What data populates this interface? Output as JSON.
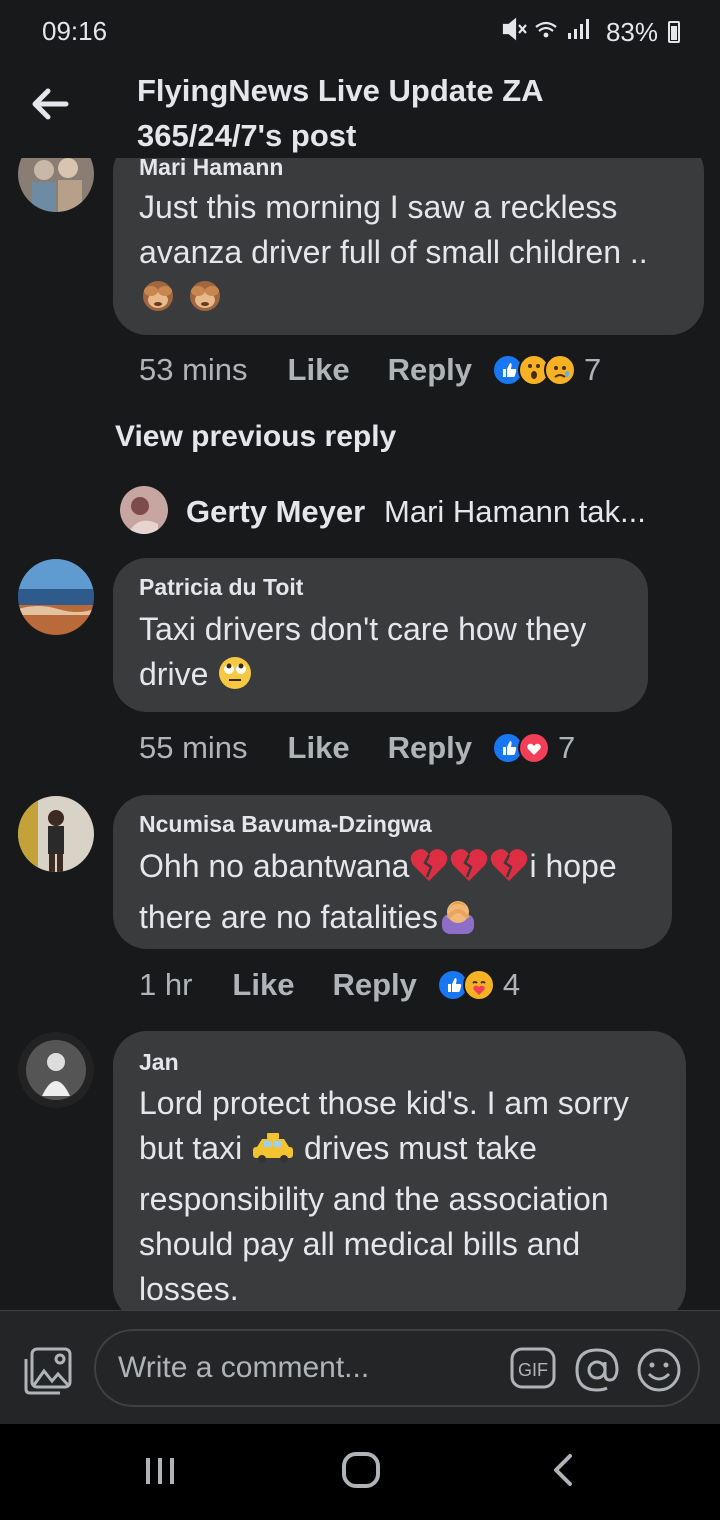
{
  "status_bar": {
    "time": "09:16",
    "battery": "83%"
  },
  "header": {
    "title_line1": "FlyingNews Live Update ZA",
    "title_line2": "365/24/7's post"
  },
  "comments": [
    {
      "author": "Mari Hamann",
      "text_line1": "Just this morning I saw a reckless",
      "text_line2": "avanza driver full of small children ..",
      "time": "53 mins",
      "like": "Like",
      "reply": "Reply",
      "reactions_count": "7"
    },
    {
      "author": "Patricia du Toit",
      "text_line1": "Taxi  drivers don't care how they",
      "text_line2": "drive",
      "time": "55 mins",
      "like": "Like",
      "reply": "Reply",
      "reactions_count": "7"
    },
    {
      "author": "Ncumisa Bavuma-Dzingwa",
      "text_line1a": "Ohh no abantwana",
      "text_line1b": "i hope",
      "text_line2": "there are no fatalities",
      "time": "1 hr",
      "like": "Like",
      "reply": "Reply",
      "reactions_count": "4"
    },
    {
      "author": "Jan",
      "text_line1": "Lord protect those kid's. I am sorry",
      "text_line2a": "but taxi",
      "text_line2b": "drives must take",
      "text_line3": "responsibility and the association",
      "text_line4": "should pay all medical bills and",
      "text_line5": "losses."
    }
  ],
  "view_previous_reply": "View previous reply",
  "reply_preview": {
    "author": "Gerty Meyer",
    "text": "Mari Hamann tak..."
  },
  "composer": {
    "placeholder": "Write a comment...",
    "gif": "GIF"
  },
  "colors": {
    "background": "#18191a",
    "bubble": "#3a3b3c",
    "like_blue": "#1877f2",
    "love_red": "#f33e58",
    "wow_yellow": "#f7b125"
  }
}
